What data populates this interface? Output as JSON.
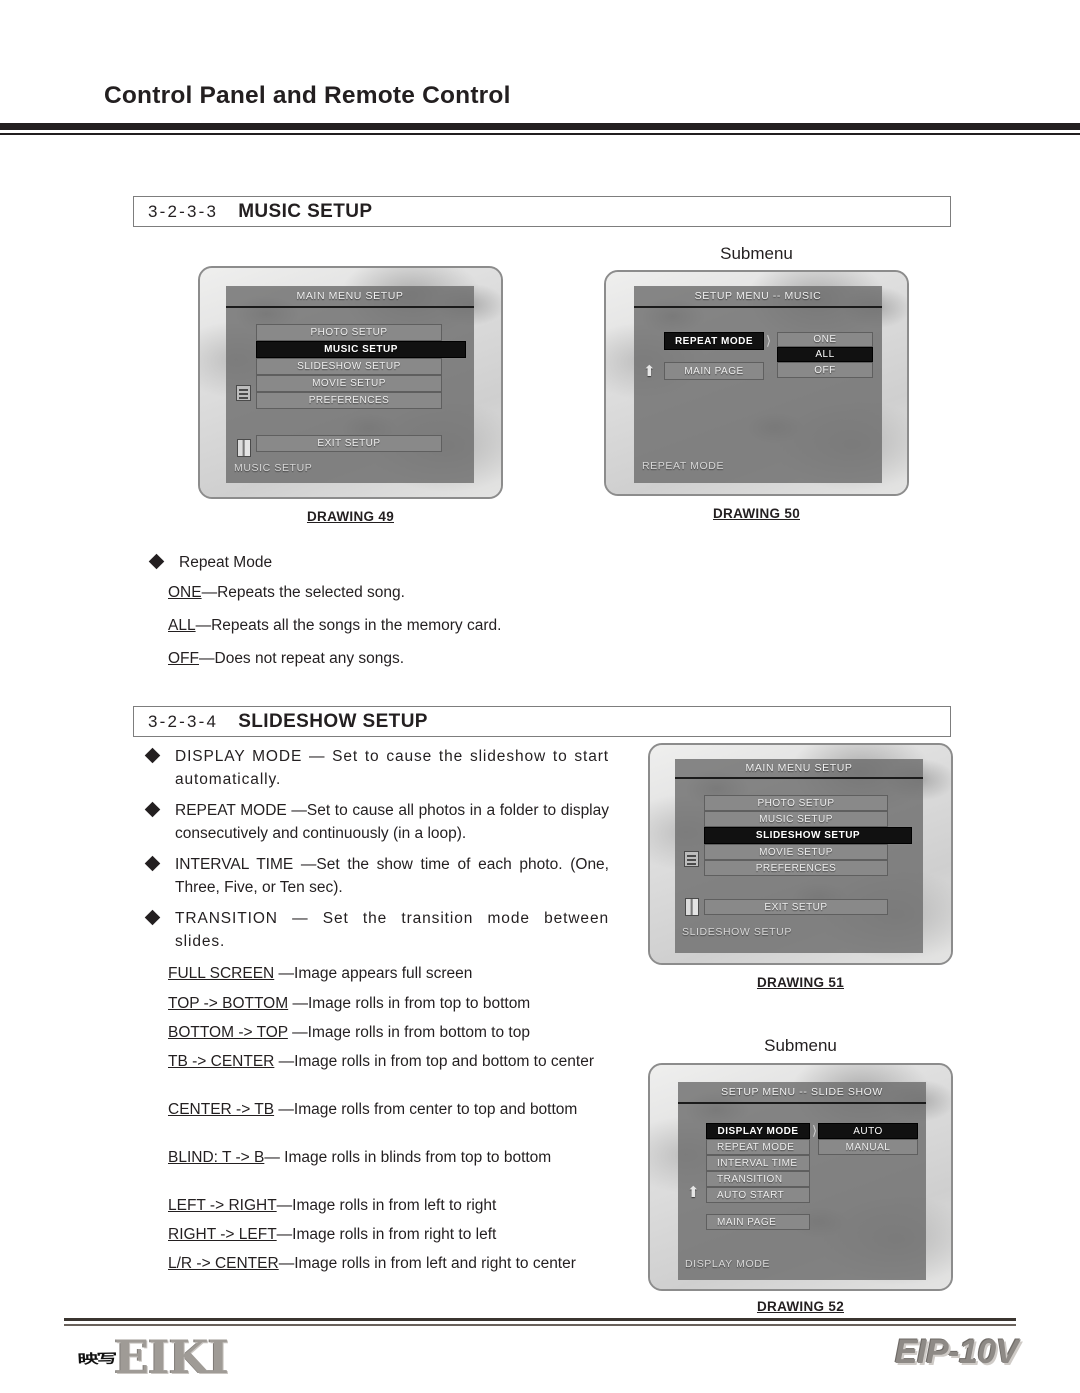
{
  "header": {
    "title": "Control Panel and Remote Control"
  },
  "sections": [
    {
      "number": "3-2-3-3",
      "name": "MUSIC SETUP"
    },
    {
      "number": "3-2-3-4",
      "name": "SLIDESHOW SETUP"
    }
  ],
  "music": {
    "bullet": "Repeat Mode",
    "options": [
      {
        "term": "ONE",
        "desc": "—Repeats the selected song."
      },
      {
        "term": "ALL",
        "desc": "—Repeats all the songs in the memory card."
      },
      {
        "term": "OFF",
        "desc": "—Does not repeat any songs."
      }
    ]
  },
  "slideshow": {
    "bullets": [
      "DISPLAY MODE — Set to cause the slideshow to start automatically.",
      "REPEAT MODE —Set to cause all photos in a folder to display consecutively and continuously (in a loop).",
      "INTERVAL TIME —Set the show time of each photo. (One, Three, Five, or Ten sec).",
      "TRANSITION — Set the transition mode between slides."
    ],
    "transitions": [
      {
        "term": "FULL SCREEN",
        "desc": " —Image appears full screen"
      },
      {
        "term": "TOP -> BOTTOM",
        "desc": " —Image rolls in from top to bottom"
      },
      {
        "term": "BOTTOM -> TOP",
        "desc": " —Image rolls in from bottom to top"
      },
      {
        "term": "TB -> CENTER",
        "desc": " —Image rolls in from top and bottom to center"
      },
      {
        "term": "CENTER -> TB",
        "desc": " —Image rolls from center to top and bottom"
      },
      {
        "term": "BLIND: T -> B",
        "desc": "— Image rolls in blinds from top to bottom"
      },
      {
        "term": "LEFT -> RIGHT",
        "desc": "—Image rolls in from left to right"
      },
      {
        "term": "RIGHT -> LEFT",
        "desc": "—Image rolls in from right to left"
      },
      {
        "term": "L/R -> CENTER",
        "desc": "—Image rolls in from left and right to center"
      }
    ]
  },
  "figures": {
    "submenu_label": "Submenu",
    "drawing49": {
      "caption": "DRAWING 49",
      "osd_title": "MAIN MENU SETUP",
      "items": [
        "PHOTO SETUP",
        "MUSIC SETUP",
        "SLIDESHOW SETUP",
        "MOVIE SETUP",
        "PREFERENCES"
      ],
      "selected": "MUSIC SETUP",
      "exit": "EXIT SETUP",
      "status": "MUSIC SETUP"
    },
    "drawing50": {
      "caption": "DRAWING 50",
      "osd_title": "SETUP MENU -- MUSIC",
      "items": [
        "REPEAT MODE",
        "MAIN PAGE"
      ],
      "selected": "REPEAT MODE",
      "values": [
        "ONE",
        "ALL",
        "OFF"
      ],
      "value_selected": "ALL",
      "status": "REPEAT MODE"
    },
    "drawing51": {
      "caption": "DRAWING 51",
      "osd_title": "MAIN MENU SETUP",
      "items": [
        "PHOTO SETUP",
        "MUSIC SETUP",
        "SLIDESHOW SETUP",
        "MOVIE SETUP",
        "PREFERENCES"
      ],
      "selected": "SLIDESHOW SETUP",
      "exit": "EXIT SETUP",
      "status": "SLIDESHOW SETUP"
    },
    "drawing52": {
      "caption": "DRAWING 52",
      "osd_title": "SETUP MENU -- SLIDE SHOW",
      "items": [
        "DISPLAY MODE",
        "REPEAT MODE",
        "INTERVAL TIME",
        "TRANSITION",
        "AUTO START"
      ],
      "selected": "DISPLAY MODE",
      "main_page": "MAIN PAGE",
      "values": [
        "AUTO",
        "MANUAL"
      ],
      "value_selected": "AUTO",
      "status": "DISPLAY MODE"
    }
  },
  "footer": {
    "brand_mark": "映写",
    "brand_name": "EIKI",
    "model": "EIP-10V"
  }
}
